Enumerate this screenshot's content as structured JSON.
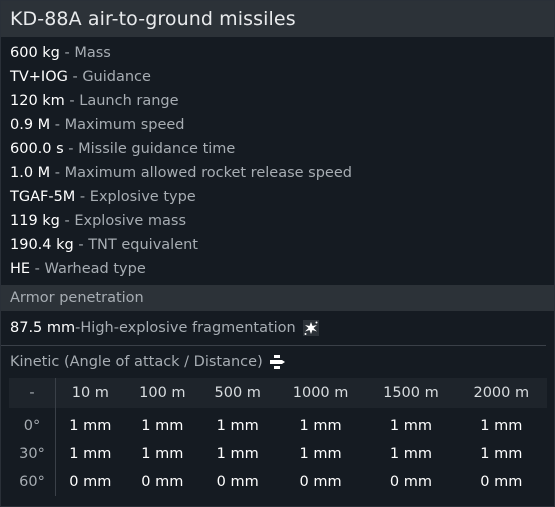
{
  "title": "KD-88A air-to-ground missiles",
  "separator": " - ",
  "stats": [
    {
      "value": "600 kg",
      "label": "Mass"
    },
    {
      "value": "TV+IOG",
      "label": "Guidance"
    },
    {
      "value": "120 km",
      "label": "Launch range"
    },
    {
      "value": "0.9 M",
      "label": "Maximum speed"
    },
    {
      "value": "600.0 s",
      "label": "Missile guidance time"
    },
    {
      "value": "1.0 M",
      "label": "Maximum allowed rocket release speed"
    },
    {
      "value": "TGAF-5M",
      "label": "Explosive type"
    },
    {
      "value": "119 kg",
      "label": "Explosive mass"
    },
    {
      "value": "190.4 kg",
      "label": "TNT equivalent"
    },
    {
      "value": "HE",
      "label": "Warhead type"
    }
  ],
  "armor_penetration": {
    "header": "Armor penetration",
    "he_frag": {
      "value": "87.5 mm",
      "label": "High-explosive fragmentation",
      "icon": "explosion-icon"
    },
    "kinetic": {
      "title": "Kinetic (Angle of attack / Distance)",
      "icon": "projectile-icon",
      "corner": "-",
      "distances": [
        "10 m",
        "100 m",
        "500 m",
        "1000 m",
        "1500 m",
        "2000 m"
      ],
      "rows": [
        {
          "angle": "0°",
          "values": [
            "1 mm",
            "1 mm",
            "1 mm",
            "1 mm",
            "1 mm",
            "1 mm"
          ]
        },
        {
          "angle": "30°",
          "values": [
            "1 mm",
            "1 mm",
            "1 mm",
            "1 mm",
            "1 mm",
            "1 mm"
          ]
        },
        {
          "angle": "60°",
          "values": [
            "0 mm",
            "0 mm",
            "0 mm",
            "0 mm",
            "0 mm",
            "0 mm"
          ]
        }
      ]
    }
  }
}
